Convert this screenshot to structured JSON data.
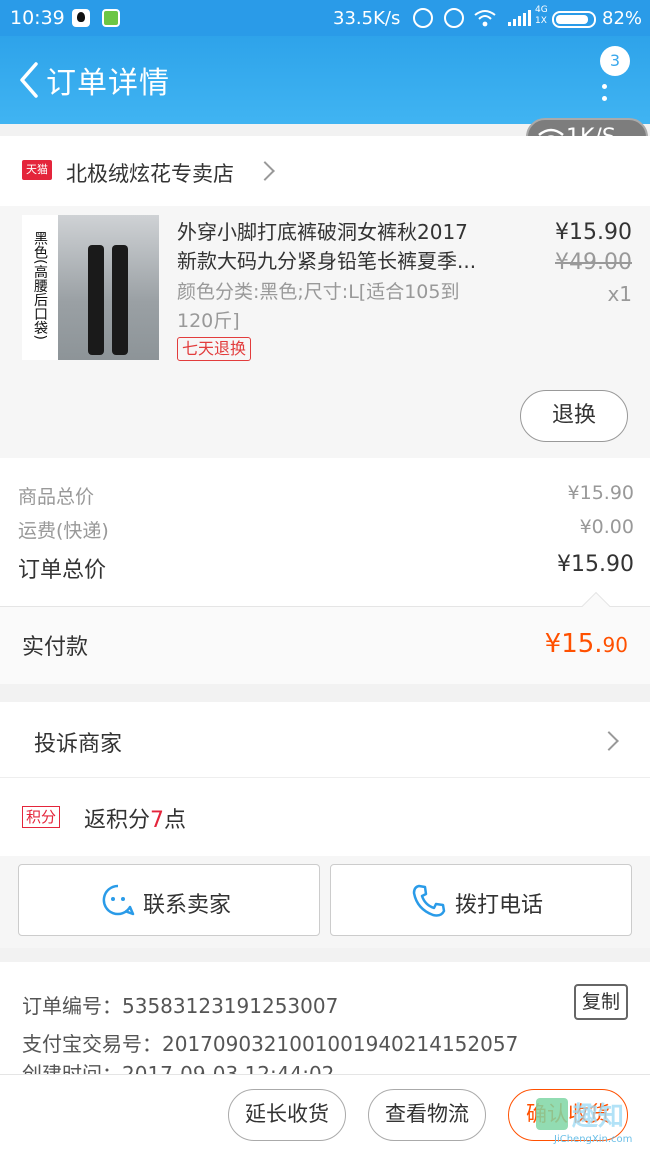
{
  "status_bar": {
    "time": "10:39",
    "net_speed": "33.5K/s",
    "network_label_top": "4G",
    "network_label_bottom": "1X",
    "battery": "82%"
  },
  "header": {
    "title": "订单详情",
    "badge_count": "3"
  },
  "net_float": "1K/S",
  "shop": {
    "logo_text": "天猫",
    "name": "北极绒炫花专卖店"
  },
  "product": {
    "image_tag": "黑色(高腰后口袋)",
    "name_line1": "外穿小脚打底裤破洞女裤秋2017",
    "name_line2": "新款大码九分紧身铅笔长裤夏季...",
    "attr_line1": "颜色分类:黑色;尺寸:L[适合105到",
    "attr_line2": "120斤]",
    "badge": "七天退换",
    "price": "¥15.90",
    "original_price": "¥49.00",
    "quantity": "x1",
    "refund_button": "退换"
  },
  "totals": {
    "goods_label": "商品总价",
    "goods_value": "¥15.90",
    "shipping_label": "运费(快递)",
    "shipping_value": "¥0.00",
    "order_label": "订单总价",
    "order_value": "¥15.90",
    "paid_label": "实付款",
    "paid_int": "¥15.",
    "paid_dec": "90"
  },
  "complain_label": "投诉商家",
  "points": {
    "tag": "积分",
    "prefix": "返积分",
    "num": "7",
    "suffix": "点"
  },
  "actions": {
    "contact_seller": "联系卖家",
    "call": "拨打电话"
  },
  "order_info": {
    "order_no": "订单编号：53583123191253007",
    "alipay_no": "支付宝交易号：2017090321001001940214152057",
    "created": "创建时间：2017-09-03 12:44:02",
    "copy": "复制"
  },
  "bottom": {
    "extend": "延长收货",
    "logistics": "查看物流",
    "confirm": "确认收货"
  },
  "watermark": {
    "text": "趣知",
    "url": "JiChengXin.com"
  },
  "colors": {
    "accent": "#2a9be8",
    "price_orange": "#ff5000",
    "tmall_red": "#e4253b"
  }
}
